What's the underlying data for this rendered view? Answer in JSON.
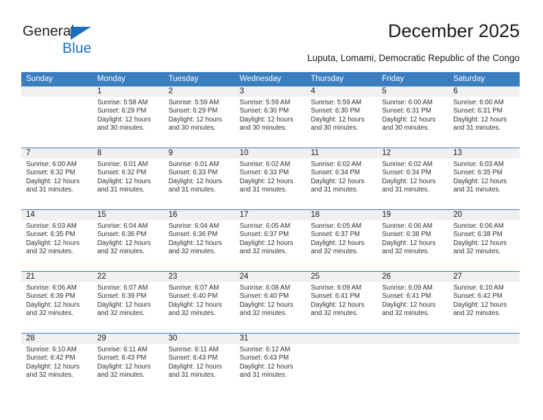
{
  "brand": {
    "name_part1": "General",
    "name_part2": "Blue",
    "color_dark": "#231f20",
    "color_blue": "#1c70bb"
  },
  "header": {
    "title": "December 2025",
    "subtitle": "Luputa, Lomami, Democratic Republic of the Congo"
  },
  "theme": {
    "header_blue": "#3a7ebf",
    "daynum_band": "#f0f0f0",
    "text": "#1a1a1a"
  },
  "weekdays": [
    "Sunday",
    "Monday",
    "Tuesday",
    "Wednesday",
    "Thursday",
    "Friday",
    "Saturday"
  ],
  "weeks": [
    [
      {
        "empty": true
      },
      {
        "day": "1",
        "sunrise": "Sunrise: 5:58 AM",
        "sunset": "Sunset: 6:29 PM",
        "daylight": "Daylight: 12 hours and 30 minutes."
      },
      {
        "day": "2",
        "sunrise": "Sunrise: 5:59 AM",
        "sunset": "Sunset: 6:29 PM",
        "daylight": "Daylight: 12 hours and 30 minutes."
      },
      {
        "day": "3",
        "sunrise": "Sunrise: 5:59 AM",
        "sunset": "Sunset: 6:30 PM",
        "daylight": "Daylight: 12 hours and 30 minutes."
      },
      {
        "day": "4",
        "sunrise": "Sunrise: 5:59 AM",
        "sunset": "Sunset: 6:30 PM",
        "daylight": "Daylight: 12 hours and 30 minutes."
      },
      {
        "day": "5",
        "sunrise": "Sunrise: 6:00 AM",
        "sunset": "Sunset: 6:31 PM",
        "daylight": "Daylight: 12 hours and 30 minutes."
      },
      {
        "day": "6",
        "sunrise": "Sunrise: 6:00 AM",
        "sunset": "Sunset: 6:31 PM",
        "daylight": "Daylight: 12 hours and 31 minutes."
      }
    ],
    [
      {
        "day": "7",
        "sunrise": "Sunrise: 6:00 AM",
        "sunset": "Sunset: 6:32 PM",
        "daylight": "Daylight: 12 hours and 31 minutes."
      },
      {
        "day": "8",
        "sunrise": "Sunrise: 6:01 AM",
        "sunset": "Sunset: 6:32 PM",
        "daylight": "Daylight: 12 hours and 31 minutes."
      },
      {
        "day": "9",
        "sunrise": "Sunrise: 6:01 AM",
        "sunset": "Sunset: 6:33 PM",
        "daylight": "Daylight: 12 hours and 31 minutes."
      },
      {
        "day": "10",
        "sunrise": "Sunrise: 6:02 AM",
        "sunset": "Sunset: 6:33 PM",
        "daylight": "Daylight: 12 hours and 31 minutes."
      },
      {
        "day": "11",
        "sunrise": "Sunrise: 6:02 AM",
        "sunset": "Sunset: 6:34 PM",
        "daylight": "Daylight: 12 hours and 31 minutes."
      },
      {
        "day": "12",
        "sunrise": "Sunrise: 6:02 AM",
        "sunset": "Sunset: 6:34 PM",
        "daylight": "Daylight: 12 hours and 31 minutes."
      },
      {
        "day": "13",
        "sunrise": "Sunrise: 6:03 AM",
        "sunset": "Sunset: 6:35 PM",
        "daylight": "Daylight: 12 hours and 31 minutes."
      }
    ],
    [
      {
        "day": "14",
        "sunrise": "Sunrise: 6:03 AM",
        "sunset": "Sunset: 6:35 PM",
        "daylight": "Daylight: 12 hours and 32 minutes."
      },
      {
        "day": "15",
        "sunrise": "Sunrise: 6:04 AM",
        "sunset": "Sunset: 6:36 PM",
        "daylight": "Daylight: 12 hours and 32 minutes."
      },
      {
        "day": "16",
        "sunrise": "Sunrise: 6:04 AM",
        "sunset": "Sunset: 6:36 PM",
        "daylight": "Daylight: 12 hours and 32 minutes."
      },
      {
        "day": "17",
        "sunrise": "Sunrise: 6:05 AM",
        "sunset": "Sunset: 6:37 PM",
        "daylight": "Daylight: 12 hours and 32 minutes."
      },
      {
        "day": "18",
        "sunrise": "Sunrise: 6:05 AM",
        "sunset": "Sunset: 6:37 PM",
        "daylight": "Daylight: 12 hours and 32 minutes."
      },
      {
        "day": "19",
        "sunrise": "Sunrise: 6:06 AM",
        "sunset": "Sunset: 6:38 PM",
        "daylight": "Daylight: 12 hours and 32 minutes."
      },
      {
        "day": "20",
        "sunrise": "Sunrise: 6:06 AM",
        "sunset": "Sunset: 6:38 PM",
        "daylight": "Daylight: 12 hours and 32 minutes."
      }
    ],
    [
      {
        "day": "21",
        "sunrise": "Sunrise: 6:06 AM",
        "sunset": "Sunset: 6:39 PM",
        "daylight": "Daylight: 12 hours and 32 minutes."
      },
      {
        "day": "22",
        "sunrise": "Sunrise: 6:07 AM",
        "sunset": "Sunset: 6:39 PM",
        "daylight": "Daylight: 12 hours and 32 minutes."
      },
      {
        "day": "23",
        "sunrise": "Sunrise: 6:07 AM",
        "sunset": "Sunset: 6:40 PM",
        "daylight": "Daylight: 12 hours and 32 minutes."
      },
      {
        "day": "24",
        "sunrise": "Sunrise: 6:08 AM",
        "sunset": "Sunset: 6:40 PM",
        "daylight": "Daylight: 12 hours and 32 minutes."
      },
      {
        "day": "25",
        "sunrise": "Sunrise: 6:09 AM",
        "sunset": "Sunset: 6:41 PM",
        "daylight": "Daylight: 12 hours and 32 minutes."
      },
      {
        "day": "26",
        "sunrise": "Sunrise: 6:09 AM",
        "sunset": "Sunset: 6:41 PM",
        "daylight": "Daylight: 12 hours and 32 minutes."
      },
      {
        "day": "27",
        "sunrise": "Sunrise: 6:10 AM",
        "sunset": "Sunset: 6:42 PM",
        "daylight": "Daylight: 12 hours and 32 minutes."
      }
    ],
    [
      {
        "day": "28",
        "sunrise": "Sunrise: 6:10 AM",
        "sunset": "Sunset: 6:42 PM",
        "daylight": "Daylight: 12 hours and 32 minutes."
      },
      {
        "day": "29",
        "sunrise": "Sunrise: 6:11 AM",
        "sunset": "Sunset: 6:43 PM",
        "daylight": "Daylight: 12 hours and 32 minutes."
      },
      {
        "day": "30",
        "sunrise": "Sunrise: 6:11 AM",
        "sunset": "Sunset: 6:43 PM",
        "daylight": "Daylight: 12 hours and 31 minutes."
      },
      {
        "day": "31",
        "sunrise": "Sunrise: 6:12 AM",
        "sunset": "Sunset: 6:43 PM",
        "daylight": "Daylight: 12 hours and 31 minutes."
      },
      {
        "empty": true
      },
      {
        "empty": true
      },
      {
        "empty": true
      }
    ]
  ]
}
